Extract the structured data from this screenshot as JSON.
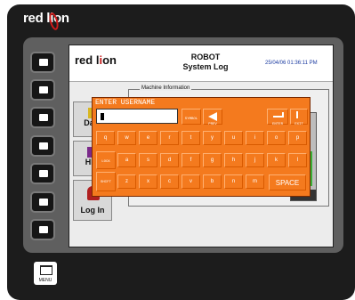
{
  "brand": "red lion",
  "screen": {
    "logo": "red lion",
    "title_line1": "ROBOT",
    "title_line2": "System Log",
    "datetime": "25/04/06 01:36:11 PM",
    "panel_label": "Machine Information",
    "nav": [
      {
        "label": "Data"
      },
      {
        "label": "HMI"
      },
      {
        "label": "Log In"
      }
    ]
  },
  "keyboard": {
    "title": "ENTER USERNAME",
    "value": "",
    "symbol_label": "SYMBOL",
    "prev_label": "PREV",
    "enter_label": "ENTER",
    "exit_label": "EXIT",
    "row1": [
      "q",
      "w",
      "e",
      "r",
      "t",
      "y",
      "u",
      "i",
      "o",
      "p"
    ],
    "lock_label": "LOCK",
    "row2": [
      "a",
      "s",
      "d",
      "f",
      "g",
      "h",
      "j",
      "k",
      "l"
    ],
    "shift_label": "SHIFT",
    "row3": [
      "z",
      "x",
      "c",
      "v",
      "b",
      "n",
      "m"
    ],
    "space_label": "SPACE"
  },
  "menu_key": {
    "label": "MENU"
  },
  "gauge": {
    "level": 0.55,
    "color": "#38b038"
  },
  "colors": {
    "keyboard": "#f47a1e",
    "brand_red": "#c31a1a",
    "bezel": "#1c1c1c"
  }
}
